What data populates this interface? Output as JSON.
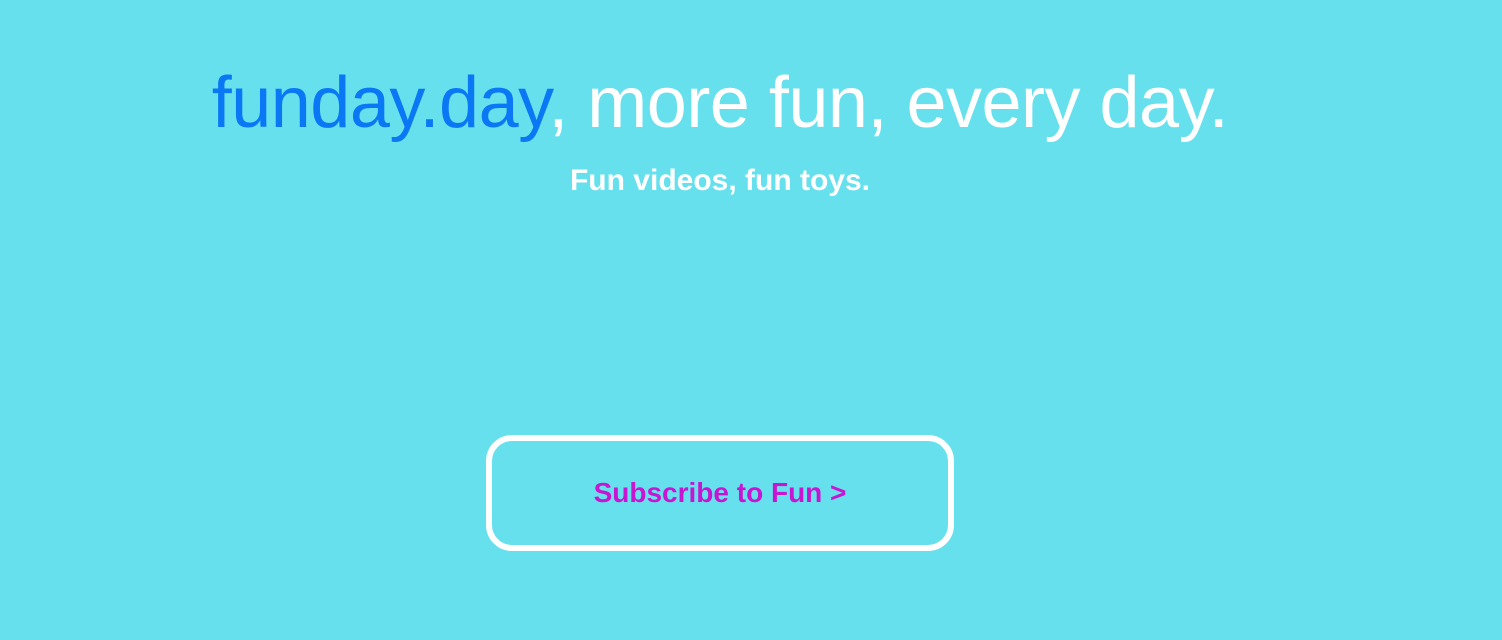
{
  "hero": {
    "brand": "funday.day",
    "headline_rest": ", more fun, every day.",
    "tagline": "Fun videos, fun toys.",
    "subscribe_label": "Subscribe to Fun >"
  },
  "colors": {
    "background": "#67E0EE",
    "brand": "#0A78F5",
    "headline": "#FFFFFF",
    "button_text": "#C815D2",
    "button_border": "#FFFFFF"
  }
}
